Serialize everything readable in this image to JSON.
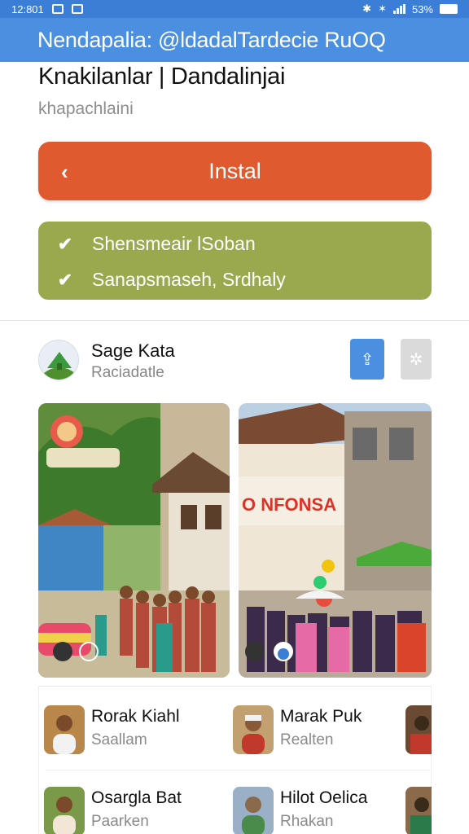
{
  "status_bar": {
    "time": "12:801",
    "battery": "53%"
  },
  "app_bar": {
    "title": "Nendapalia: @ldadalTardecie RuOQ"
  },
  "app": {
    "title": "Knakilanlar | Dandalinjai",
    "subtitle": "khapachlaini"
  },
  "install_button": {
    "label": "Instal",
    "icon": "back-arrow-icon"
  },
  "features": [
    {
      "label": "Shensmeair lSoban",
      "icon": "check-icon"
    },
    {
      "label": "Sanapsmaseh, Srdhaly",
      "icon": "check-icon"
    }
  ],
  "developer": {
    "name": "Sage Kata",
    "subtitle": "Raciadatle"
  },
  "screenshots": [
    {
      "banner_text": ""
    },
    {
      "banner_text": "O NFONSA"
    }
  ],
  "people": [
    {
      "name": "Rorak Kiahl",
      "subtitle": "Saallam"
    },
    {
      "name": "Marak Puk",
      "subtitle": "Realten"
    },
    {
      "name": "Osargla Bat",
      "subtitle": "Paarken"
    },
    {
      "name": "Hilot Oelica",
      "subtitle": "Rhakan"
    }
  ],
  "colors": {
    "app_bar": "#4a8fe0",
    "install_button": "#e05a30",
    "features_box": "#9aa84e"
  }
}
